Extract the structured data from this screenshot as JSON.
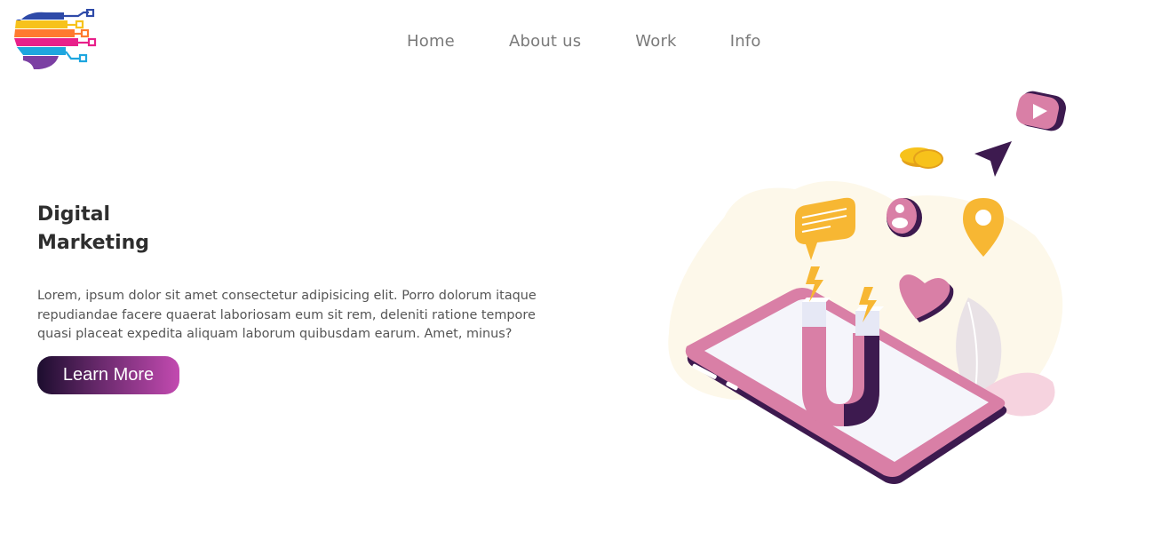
{
  "header": {
    "logo_name": "ai-head-circuit-logo",
    "nav": [
      {
        "label": "Home"
      },
      {
        "label": "About us"
      },
      {
        "label": "Work"
      },
      {
        "label": "Info"
      }
    ]
  },
  "hero": {
    "title_line1": "Digital",
    "title_line2": "Marketing",
    "description": "Lorem, ipsum dolor sit amet consectetur adipisicing elit. Porro dolorum itaque repudiandae facere quaerat laboriosam eum sit rem, deleniti ratione tempore quasi placeat expedita aliquam laborum quibusdam earum. Amet, minus?",
    "cta_label": "Learn More"
  },
  "illustration": {
    "icons": [
      "smartphone",
      "magnet-icon",
      "chat-bubble-icon",
      "user-badge-icon",
      "location-pin-icon",
      "heart-icon",
      "play-button-icon",
      "send-arrow-icon",
      "coins-icon",
      "lightning-icon",
      "leaf-plant"
    ]
  },
  "colors": {
    "nav_text": "#7a7a7a",
    "title_text": "#2e2e2e",
    "body_text": "#555555",
    "cta_gradient_start": "#1c0d2e",
    "cta_gradient_end": "#c24ab0",
    "accent_pink": "#d97fa6",
    "accent_purple": "#3d1a4f",
    "accent_yellow": "#f7b733"
  }
}
